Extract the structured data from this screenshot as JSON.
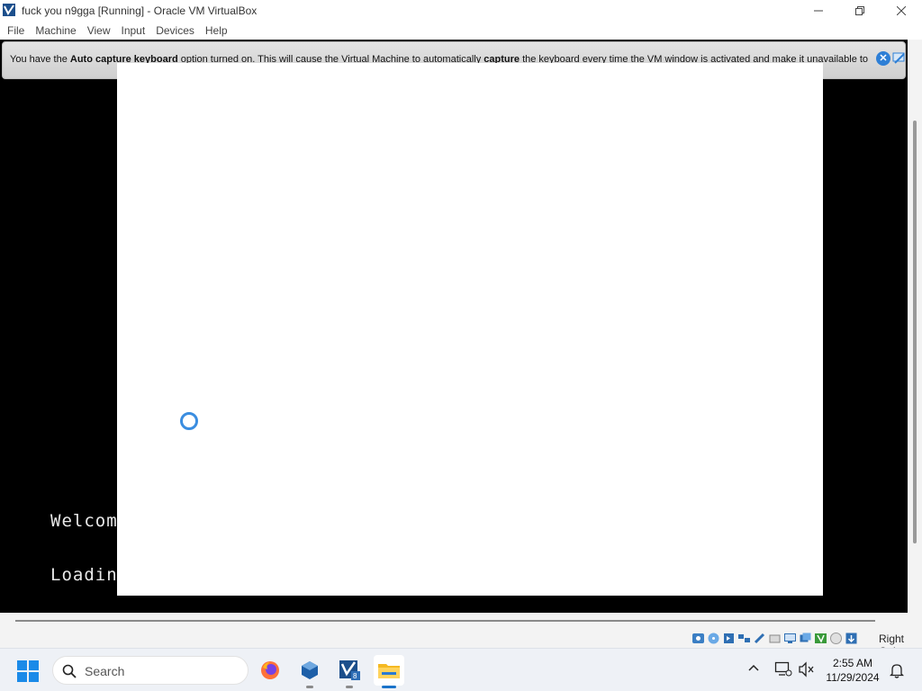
{
  "window": {
    "title": "fuck you n9gga [Running] - Oracle VM VirtualBox",
    "icon": "virtualbox-icon"
  },
  "menu": {
    "items": [
      {
        "label": "File"
      },
      {
        "label": "Machine"
      },
      {
        "label": "View"
      },
      {
        "label": "Input"
      },
      {
        "label": "Devices"
      },
      {
        "label": "Help"
      }
    ]
  },
  "notice": {
    "part1": "You have the ",
    "bold1": "Auto capture keyboard",
    "part2": " option turned on. This will cause the Virtual Machine to automatically ",
    "bold2": "capture",
    "part3": " the keyboard every time the VM window is activated and make it unavailable to",
    "close_icon": "close-icon",
    "hide_icon": "do-not-show-again-icon"
  },
  "console": {
    "line1": "Welcome",
    "line2": "Loading"
  },
  "statusbar": {
    "host_key": "Right Ctrl",
    "icons": [
      "hard-disk-icon",
      "optical-drive-icon",
      "audio-icon",
      "network-icon",
      "usb-icon",
      "shared-folders-icon",
      "display-icon",
      "video-capture-icon",
      "guest-additions-icon",
      "mouse-integration-icon",
      "keyboard-capture-icon"
    ]
  },
  "taskbar": {
    "search_label": "Search",
    "apps": [
      "firefox-icon",
      "virtualbox-manager-icon",
      "virtualbox-vm-icon",
      "file-explorer-icon"
    ],
    "time": "2:55 AM",
    "date": "11/29/2024"
  },
  "colors": {
    "vm_background": "#000000",
    "accent": "#1a73c9",
    "spinner": "#3a8de0"
  }
}
